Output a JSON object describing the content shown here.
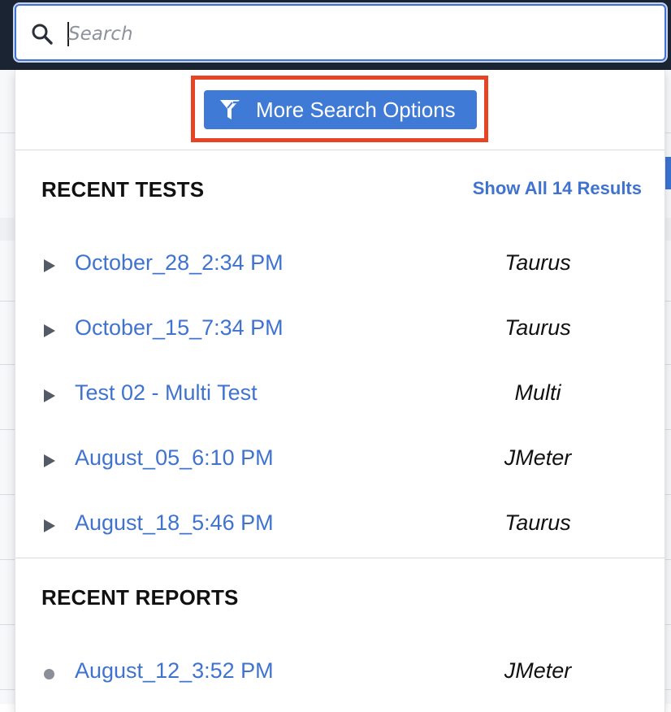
{
  "search": {
    "placeholder": "Search",
    "value": ""
  },
  "options": {
    "more_search_options_label": "More Search Options"
  },
  "recent_tests": {
    "title": "RECENT TESTS",
    "show_all_label": "Show All 14 Results",
    "items": [
      {
        "name": "October_28_2:34 PM",
        "type": "Taurus"
      },
      {
        "name": "October_15_7:34 PM",
        "type": "Taurus"
      },
      {
        "name": "Test 02 - Multi Test",
        "type": "Multi"
      },
      {
        "name": "August_05_6:10 PM",
        "type": "JMeter"
      },
      {
        "name": "August_18_5:46 PM",
        "type": "Taurus"
      }
    ]
  },
  "recent_reports": {
    "title": "RECENT REPORTS",
    "items": [
      {
        "name": "August_12_3:52 PM",
        "type": "JMeter"
      }
    ]
  },
  "colors": {
    "accent": "#3f73cf",
    "button": "#3f7ad6",
    "highlight": "#e64425",
    "topbar": "#1b2433"
  },
  "icons": {
    "search": "search-icon",
    "filter": "filter-icon",
    "test_item": "play-triangle-icon",
    "report_item": "dot-icon"
  }
}
